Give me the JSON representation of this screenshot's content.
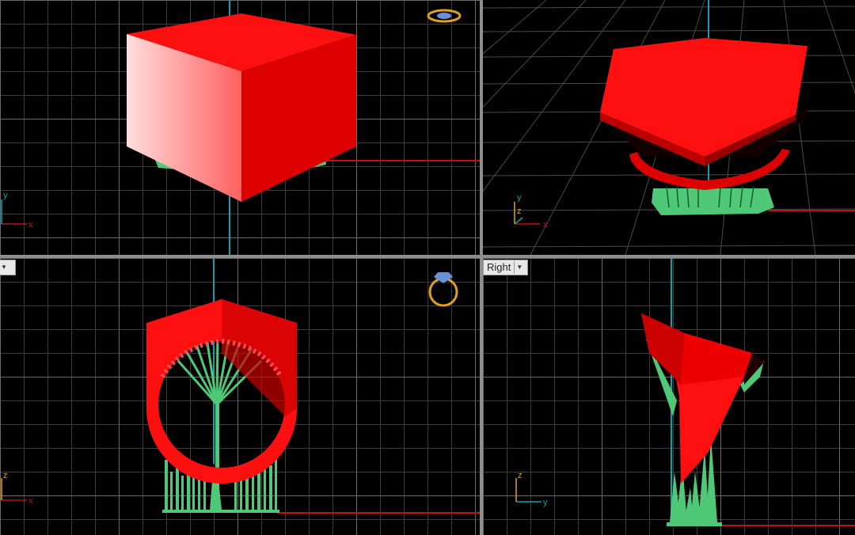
{
  "viewports": {
    "top": {
      "label": ""
    },
    "perspective": {
      "label": ""
    },
    "front": {
      "label": ""
    },
    "right": {
      "label": "Right"
    }
  },
  "axes": {
    "x": "x",
    "y": "y",
    "z": "z"
  },
  "icons": {
    "ring_top": "ring-top-icon",
    "ring_front": "ring-front-icon",
    "dropdown": "chevron-down-icon"
  },
  "colors": {
    "model": "#ff0000",
    "supports": "#4fc878",
    "grid": "#3c3c3c",
    "grid_major": "#6a6a6a",
    "axis_x": "#c01010",
    "axis_y": "#10a0b0",
    "gizmo": "#e0a020",
    "background": "#000000"
  }
}
